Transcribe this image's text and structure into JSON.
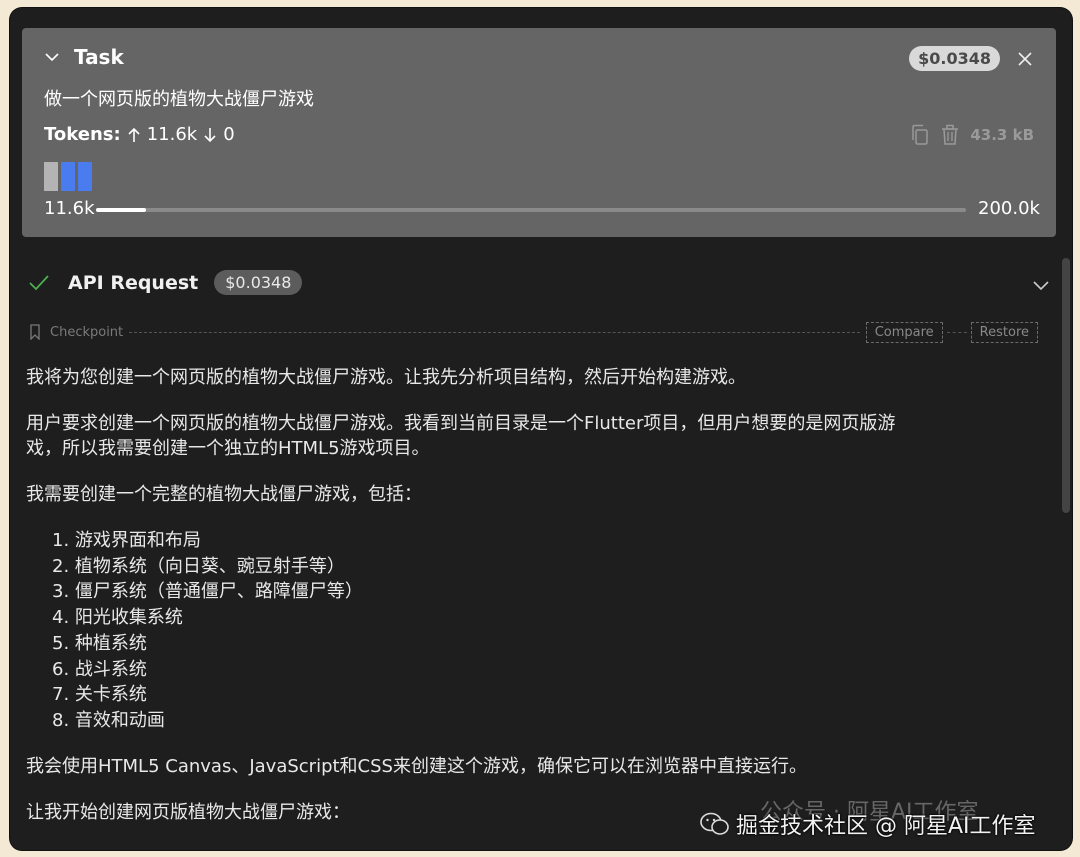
{
  "task": {
    "title": "Task",
    "cost": "$0.0348",
    "description": "做一个网页版的植物大战僵尸游戏",
    "tokens_label": "Tokens:",
    "tokens_in": "11.6k",
    "tokens_out": "0",
    "size": "43.3 kB",
    "context_used": "11.6k",
    "context_max": "200.0k",
    "context_fraction": 0.058
  },
  "api": {
    "title": "API Request",
    "cost": "$0.0348"
  },
  "checkpoint": {
    "label": "Checkpoint",
    "compare": "Compare",
    "restore": "Restore"
  },
  "messages": {
    "p1": "我将为您创建一个网页版的植物大战僵尸游戏。让我先分析项目结构，然后开始构建游戏。",
    "p2a": "用户要求创建一个网页版的植物大战僵尸游戏。我看到当前目录是一个Flutter项目，但用户想要的是网页版游",
    "p2b": "戏，所以我需要创建一个独立的HTML5游戏项目。",
    "p3": "我需要创建一个完整的植物大战僵尸游戏，包括：",
    "list": [
      "1. 游戏界面和布局",
      "2. 植物系统（向日葵、豌豆射手等）",
      "3. 僵尸系统（普通僵尸、路障僵尸等）",
      "4. 阳光收集系统",
      "5. 种植系统",
      "6. 战斗系统",
      "7. 关卡系统",
      "8. 音效和动画"
    ],
    "p4": "我会使用HTML5 Canvas、JavaScript和CSS来创建这个游戏，确保它可以在浏览器中直接运行。",
    "p5": "让我开始创建网页版植物大战僵尸游戏："
  },
  "watermark": {
    "faint": "公众号 · 阿星AI工作室",
    "text": "掘金技术社区 @ 阿星AI工作室"
  },
  "colors": {
    "window_bg": "#1e1e1e",
    "task_bg": "#656565",
    "ctx_block_gray": "#b4b4b4",
    "ctx_block_blue": "#4a7cf0",
    "check_green": "#4caf50"
  }
}
